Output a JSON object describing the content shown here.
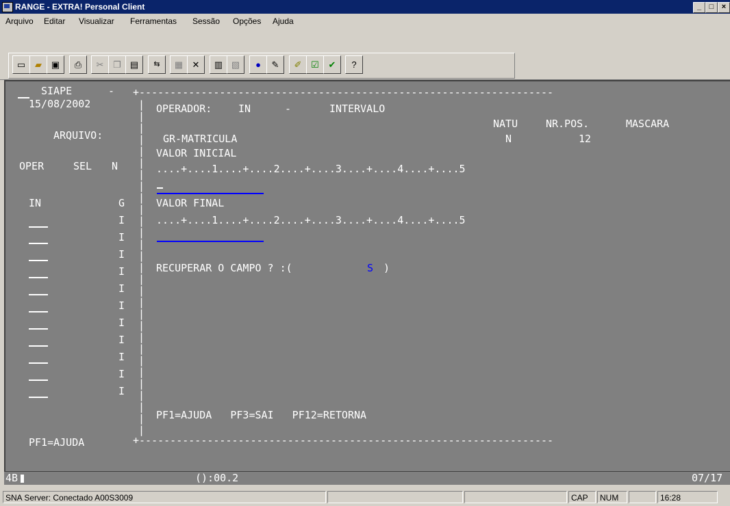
{
  "window": {
    "title": "RANGE - EXTRA! Personal Client",
    "minimize": "_",
    "maximize": "□",
    "close": "×"
  },
  "menu": [
    "Arquivo",
    "Editar",
    "Visualizar",
    "Ferramentas",
    "Sessão",
    "Opções",
    "Ajuda"
  ],
  "toolbar_icons": [
    "new-document-icon",
    "open-folder-icon",
    "save-icon",
    "print-icon",
    "cut-icon",
    "copy-icon",
    "paste-icon",
    "send-receive-icon",
    "screen-icon",
    "tools-icon",
    "file-transfer-icon",
    "macro-icon",
    "record-icon",
    "quick-pad-icon",
    "edit-pad-icon",
    "settings-icon",
    "check-icon",
    "help-icon"
  ],
  "terminal": {
    "system": "SIAPE",
    "date": "15/08/2002",
    "arquivo_label": "ARQUIVO:",
    "col_headers": {
      "oper": "OPER",
      "sel": "SEL",
      "n": "N"
    },
    "first_oper": "IN",
    "n_values": [
      "G",
      "I",
      "I",
      "I",
      "I",
      "I",
      "I",
      "I",
      "I",
      "I",
      "I",
      "I"
    ],
    "operador_label": "OPERADOR:",
    "operador_code": "IN",
    "operador_dash": "-",
    "operador_name": "INTERVALO",
    "hdr_natu": "NATU",
    "hdr_nrpos": "NR.POS.",
    "hdr_mascara": "MASCARA",
    "field_name": "GR-MATRICULA",
    "natu_value": "N",
    "nrpos_value": "12",
    "valor_inicial_label": "VALOR INICIAL",
    "ruler": "....+....1....+....2....+....3....+....4....+....5",
    "valor_final_label": "VALOR FINAL",
    "recuperar_label": "RECUPERAR O CAMPO ? :(",
    "recuperar_value": "S",
    "recuperar_close": ")",
    "pf_keys": "PF1=AJUDA   PF3=SAI   PF12=RETORNA",
    "pf_left": "PF1=AJUDA"
  },
  "oia": {
    "left": "4B",
    "center": "():00.2",
    "right": "07/17"
  },
  "status": {
    "server": "SNA Server: Conectado A00S3009",
    "cap": "CAP",
    "num": "NUM",
    "time": "16:28"
  },
  "colors": {
    "title_bg": "#0a246a",
    "terminal_bg": "#808080",
    "field_underline": "#0000ff",
    "highlight": "#0000ff"
  }
}
